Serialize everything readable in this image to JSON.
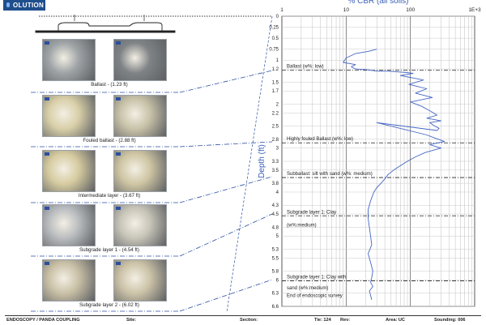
{
  "brand": {
    "logo_text": "OLUTION",
    "accent": "#1f4e8c"
  },
  "rows": [
    {
      "caption": "Ballast - (1.23 ft)",
      "left_tone": "#9ea3a6",
      "right_tone": "#7f8386"
    },
    {
      "caption": "Fouled ballast - (2.88 ft)",
      "left_tone": "#d8cfa8",
      "right_tone": "#c8c2a8"
    },
    {
      "caption": "Intermediate layer - (3.67 ft)",
      "left_tone": "#d6cba0",
      "right_tone": "#cfc6a4"
    },
    {
      "caption": "Subgrade layer 1 - (4.54 ft)",
      "left_tone": "#b9bcbf",
      "right_tone": "#c7c4b8"
    },
    {
      "caption": "Subgrade layer 2 - (6.02 ft)",
      "left_tone": "#c9c0a6",
      "right_tone": "#ccc3a8"
    }
  ],
  "chart_data": {
    "type": "line",
    "title": "% CBR (all soils)",
    "xlabel": "% CBR (all soils)",
    "ylabel": "Depth (ft)",
    "x_scale": "log",
    "x_ticks": [
      {
        "label": "1",
        "value": 1
      },
      {
        "label": "10",
        "value": 10
      },
      {
        "label": "100",
        "value": 100
      },
      {
        "label": "1E+3",
        "value": 1000
      }
    ],
    "xlim": [
      1,
      1000
    ],
    "ylim": [
      0,
      6.6
    ],
    "y_ticks": [
      "0",
      "0.25",
      "0.5",
      "0.75",
      "1",
      "1.2",
      "1.5",
      "1.7",
      "2",
      "2.2",
      "2.5",
      "2.8",
      "3",
      "3.3",
      "3.5",
      "3.8",
      "4",
      "4.3",
      "4.5",
      "4.8",
      "5",
      "5.3",
      "5.5",
      "5.8",
      "6",
      "6.3",
      "6.6"
    ],
    "grid": true,
    "line_color": "#4466c4",
    "series": [
      {
        "x": [
          30,
          22,
          14,
          10,
          9,
          14,
          12,
          14,
          22,
          30,
          45,
          85,
          110,
          70,
          160,
          95,
          180,
          120,
          220,
          100,
          150,
          200,
          260,
          180,
          300,
          200,
          240,
          280,
          260,
          30,
          180,
          250,
          340,
          200,
          300,
          170,
          120,
          90,
          70,
          55,
          45,
          40,
          35,
          30,
          27,
          24,
          22,
          22,
          23,
          24,
          25,
          22,
          24,
          26,
          25,
          24,
          26,
          23,
          24,
          25
        ],
        "y": [
          0.75,
          0.8,
          0.85,
          0.95,
          1.05,
          1.1,
          1.15,
          1.2,
          1.22,
          1.25,
          1.25,
          1.28,
          1.3,
          1.35,
          1.45,
          1.55,
          1.65,
          1.75,
          1.85,
          1.95,
          2.05,
          2.15,
          2.25,
          2.32,
          2.38,
          2.42,
          2.5,
          2.55,
          2.6,
          2.42,
          2.7,
          2.78,
          2.85,
          2.92,
          3.0,
          3.1,
          3.2,
          3.3,
          3.4,
          3.5,
          3.6,
          3.7,
          3.8,
          3.9,
          4.0,
          4.2,
          4.4,
          4.6,
          4.8,
          5.0,
          5.2,
          5.4,
          5.6,
          5.8,
          5.95,
          6.05,
          6.15,
          6.25,
          6.35,
          6.45
        ]
      }
    ],
    "layers": [
      {
        "label": "Ballast (w%: low)",
        "depth": 1.23
      },
      {
        "label": "Highly fouled  Ballast (w%: low)",
        "depth": 2.88
      },
      {
        "label": "Subballast: silt with sand (w%: medium)",
        "depth": 3.67
      },
      {
        "label": "Subgrade  layer 1: Clay",
        "depth": 4.54
      },
      {
        "label": "Subgrade  layer 1: Clay with",
        "depth": 6.02
      }
    ],
    "extra_labels": [
      {
        "text": "(w%:medium)",
        "depth": 4.75
      },
      {
        "text": "sand (w%:medium)",
        "depth": 6.18
      },
      {
        "text": "End of endoscopic survey",
        "depth": 6.35
      }
    ]
  },
  "footer": {
    "title": "ENDOSCOPY / PANDA COUPLING",
    "site_label": "Site:",
    "section_label": "Section:",
    "tie_label": "Tie: 124",
    "rev_label": "Rev:",
    "area_label": "Area: UC",
    "sounding_label": "Sounding: 006"
  }
}
